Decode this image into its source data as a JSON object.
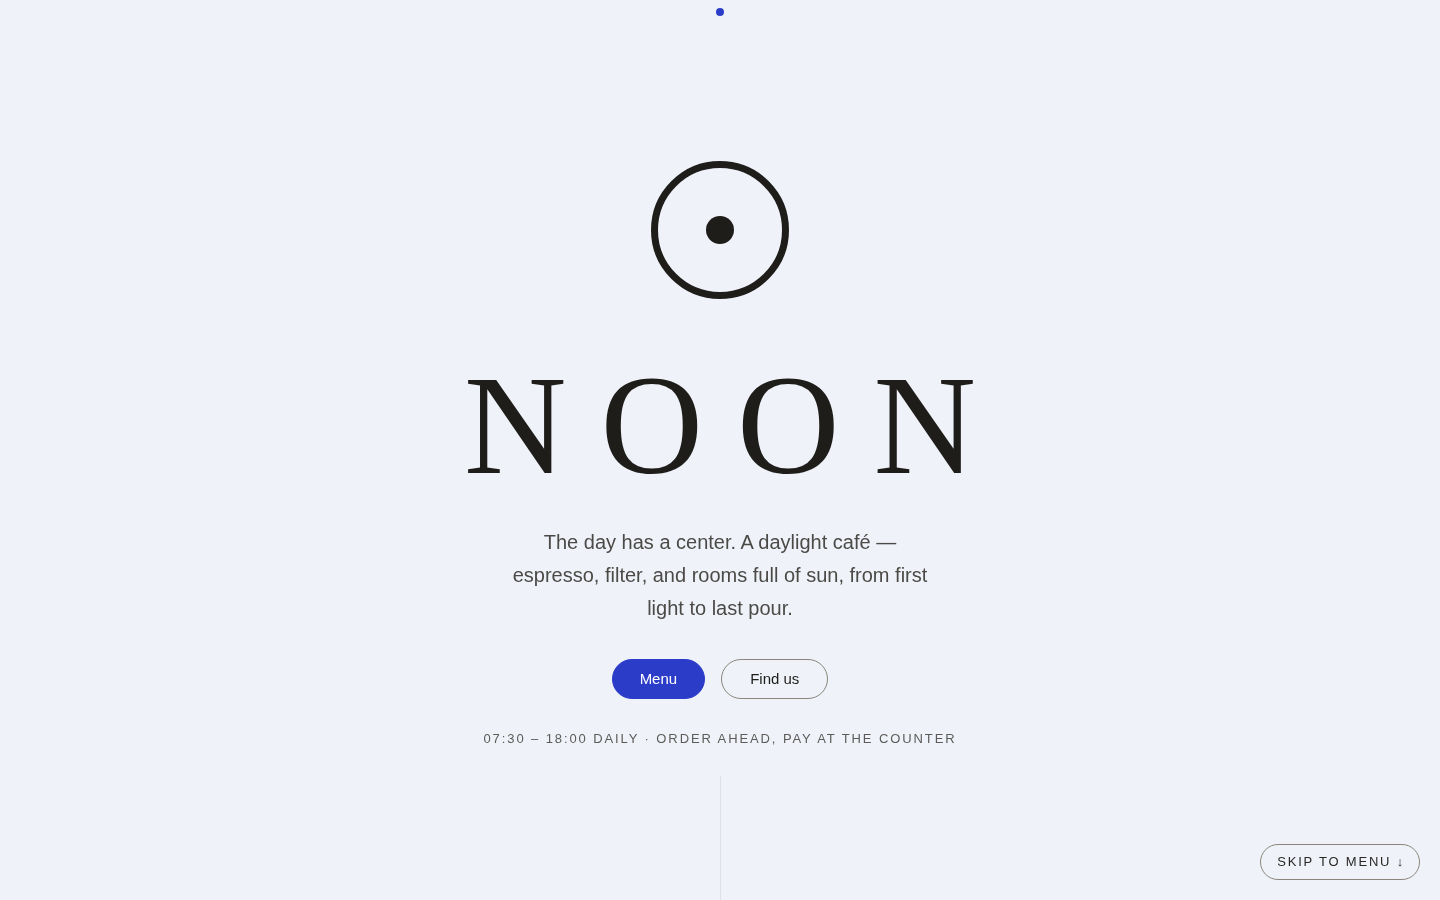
{
  "brand": {
    "name": "NOON"
  },
  "tagline": "The day has a center. A daylight café — espresso, filter, and rooms full of sun, from first light to last pour.",
  "buttons": [
    {
      "label": "Menu",
      "kind": "primary"
    },
    {
      "label": "Find us",
      "kind": "outline"
    }
  ],
  "hours_note": "07:30 – 18:00 DAILY · ORDER AHEAD, PAY AT THE COUNTER",
  "skip_link": {
    "label": "SKIP TO MENU ↓"
  }
}
